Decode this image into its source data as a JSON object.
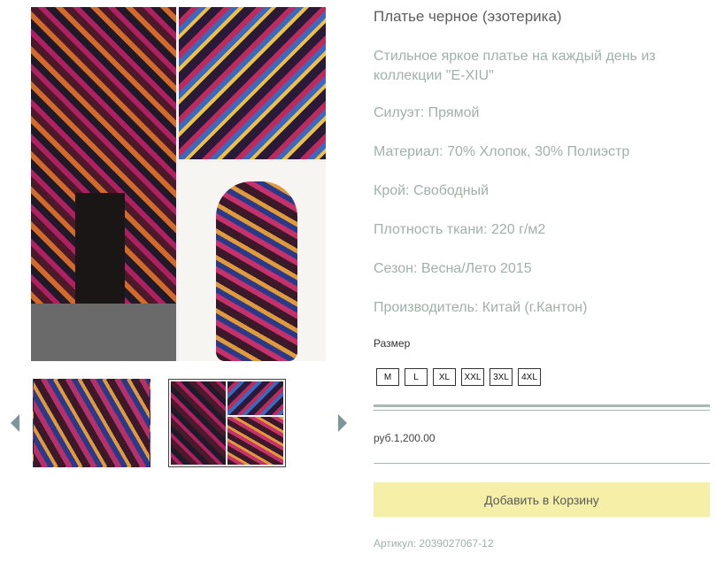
{
  "product": {
    "title": "Платье черное (эзотерика)",
    "description": "Стильное яркое платье на каждый день из коллекции \"E-XIU\"",
    "specs": [
      "Силуэт: Прямой",
      "Материал: 70% Хлопок, 30% Полиэстр",
      "Крой: Свободный",
      "Плотность ткани: 220 г/м2",
      "Сезон: Весна/Лето 2015",
      "Производитель: Китай (г.Кантон)"
    ],
    "size_label": "Размер",
    "sizes": [
      "M",
      "L",
      "XL",
      "XXL",
      "3XL",
      "4XL"
    ],
    "price": "руб.1,200.00",
    "add_to_cart": "Добавить в Корзину",
    "sku": "Артикул: 2039027067-12"
  },
  "gallery": {
    "selected_thumbnail": 2,
    "thumbnail_count": 2
  },
  "colors": {
    "accent_rule": "#a7b7b2",
    "button_bg": "#f6efa8",
    "spec_text": "#a0b1aa",
    "arrow": "#7d9699"
  },
  "icons": {
    "prev": "triangle-left",
    "next": "triangle-right"
  }
}
